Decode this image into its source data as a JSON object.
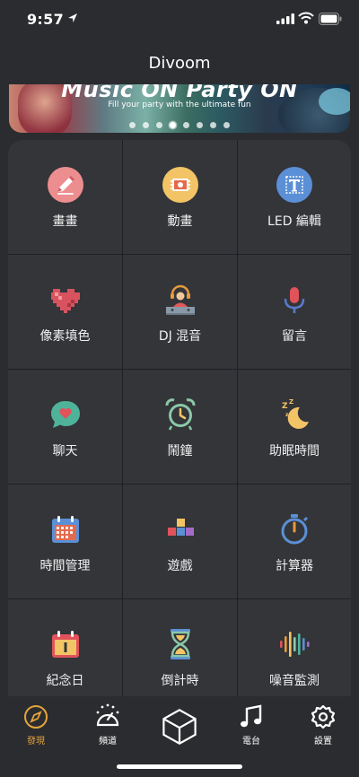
{
  "status": {
    "time": "9:57"
  },
  "nav": {
    "title": "Divoom"
  },
  "banner": {
    "headline": "Music ON  Party ON",
    "subtitle": "Fill your party with the ultimate fun",
    "page_count": 8,
    "active_page": 3
  },
  "features": [
    {
      "label": "畫畫",
      "icon": "paint-icon"
    },
    {
      "label": "動畫",
      "icon": "animation-icon"
    },
    {
      "label": "LED 編輯",
      "icon": "led-text-icon"
    },
    {
      "label": "像素填色",
      "icon": "pixel-heart-icon"
    },
    {
      "label": "DJ 混音",
      "icon": "dj-icon"
    },
    {
      "label": "留言",
      "icon": "microphone-icon"
    },
    {
      "label": "聊天",
      "icon": "chat-icon"
    },
    {
      "label": "鬧鐘",
      "icon": "alarm-clock-icon"
    },
    {
      "label": "助眠時間",
      "icon": "sleep-moon-icon"
    },
    {
      "label": "時間管理",
      "icon": "calendar-icon"
    },
    {
      "label": "遊戲",
      "icon": "game-blocks-icon"
    },
    {
      "label": "計算器",
      "icon": "stopwatch-icon"
    },
    {
      "label": "紀念日",
      "icon": "anniversary-icon"
    },
    {
      "label": "倒計時",
      "icon": "hourglass-icon"
    },
    {
      "label": "噪音監測",
      "icon": "sound-wave-icon"
    }
  ],
  "tabs": [
    {
      "label": "發現",
      "icon": "compass-icon",
      "active": true
    },
    {
      "label": "頻道",
      "icon": "channel-icon",
      "active": false
    },
    {
      "label": "",
      "icon": "cube-icon",
      "active": false
    },
    {
      "label": "電台",
      "icon": "music-note-icon",
      "active": false
    },
    {
      "label": "設置",
      "icon": "gear-icon",
      "active": false
    }
  ],
  "colors": {
    "accent": "#e4a43c",
    "background": "#2b2c2f",
    "cell": "#333539"
  }
}
